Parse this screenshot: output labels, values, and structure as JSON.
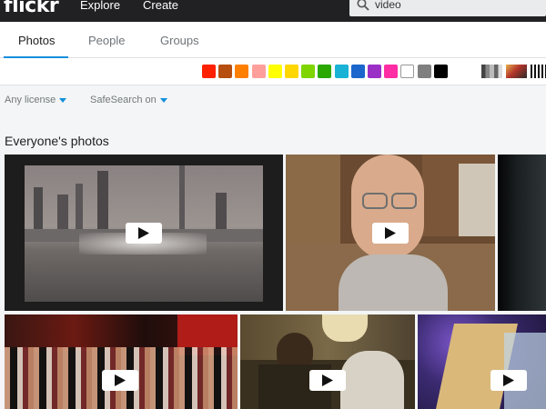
{
  "header": {
    "logo": "flickr",
    "nav": [
      "Explore",
      "Create"
    ],
    "search_value": "video"
  },
  "tabs": [
    {
      "label": "Photos",
      "active": true
    },
    {
      "label": "People",
      "active": false
    },
    {
      "label": "Groups",
      "active": false
    }
  ],
  "color_swatches": [
    "#ff2000",
    "#b54e0f",
    "#ff7f00",
    "#ff9f9c",
    "#ffff00",
    "#ffd700",
    "#7fd500",
    "#2aa800",
    "#1ab2d5",
    "#1a66cc",
    "#9b30c7",
    "#ff2ca3",
    "#ffffff",
    "#7f7f7f",
    "#000000"
  ],
  "filters": {
    "license": "Any license",
    "safesearch": "SafeSearch on"
  },
  "section_title": "Everyone's photos",
  "photos": [
    {
      "subject": "city-skyline-fountain",
      "has_video": true
    },
    {
      "subject": "man-with-glasses-webcam",
      "has_video": true
    },
    {
      "subject": "dark-partial",
      "has_video": false
    },
    {
      "subject": "crowd-on-stage",
      "has_video": true
    },
    {
      "subject": "people-on-couch",
      "has_video": true
    },
    {
      "subject": "party-lights",
      "has_video": true
    }
  ]
}
